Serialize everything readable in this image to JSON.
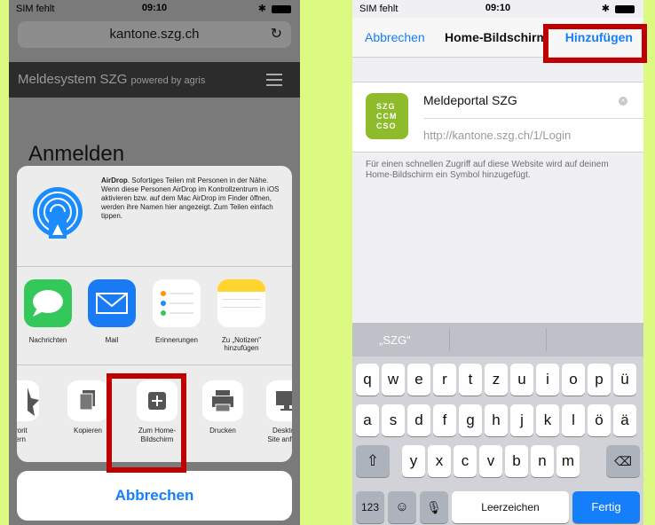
{
  "left": {
    "status": {
      "carrier": "SIM fehlt",
      "time": "09:10"
    },
    "url": "kantone.szg.ch",
    "site_title": "Meldesystem SZG",
    "site_sub": "powered by agris",
    "heading": "Anmelden",
    "airdrop": {
      "title": "AirDrop",
      "text": ". Sofortiges Teilen mit Personen in der Nähe. Wenn diese Personen AirDrop im Kontrollzentrum in iOS aktivieren bzw. auf dem Mac AirDrop im Finder öffnen, werden ihre Namen hier angezeigt. Zum Teilen einfach tippen."
    },
    "apps": [
      "Nachrichten",
      "Mail",
      "Erinnerungen",
      "Zu „Notizen\" hinzufügen"
    ],
    "actions": [
      "avorit\nhern",
      "Kopieren",
      "Zum Home-\nBildschirm",
      "Drucken",
      "Desktop-\nSite anforde"
    ],
    "cancel": "Abbrechen"
  },
  "right": {
    "status": {
      "carrier": "SIM fehlt",
      "time": "09:10"
    },
    "nav": {
      "cancel": "Abbrechen",
      "title": "Home-Bildschirm",
      "add": "Hinzufügen"
    },
    "app_icon_lines": [
      "SZG",
      "CCM",
      "CSO"
    ],
    "app_name": "Meldeportal SZG",
    "app_url": "http://kantone.szg.ch/1/Login",
    "hint": "Für einen schnellen Zugriff auf diese Website wird auf deinem Home-Bildschirm ein Symbol hinzugefügt.",
    "suggestion": "„SZG\"",
    "keys": {
      "row1": [
        "q",
        "w",
        "e",
        "r",
        "t",
        "z",
        "u",
        "i",
        "o",
        "p",
        "ü"
      ],
      "row2": [
        "a",
        "s",
        "d",
        "f",
        "g",
        "h",
        "j",
        "k",
        "l",
        "ö",
        "ä"
      ],
      "row3": [
        "y",
        "x",
        "c",
        "v",
        "b",
        "n",
        "m"
      ],
      "num": "123",
      "space": "Leerzeichen",
      "done": "Fertig"
    }
  },
  "colors": {
    "accent": "#157efb",
    "highlight_box": "#c00000",
    "background": "#dcfa82",
    "brand_green": "#8dbb2a"
  }
}
